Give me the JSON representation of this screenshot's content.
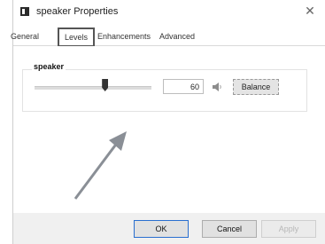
{
  "window": {
    "title": "speaker Properties",
    "close_glyph": "✕"
  },
  "tabs": [
    {
      "label": "General",
      "selected": false
    },
    {
      "label": "Levels",
      "selected": true
    },
    {
      "label": "Enhancements",
      "selected": false
    },
    {
      "label": "Advanced",
      "selected": false
    }
  ],
  "levels": {
    "group_label": "speaker",
    "slider_value": 60,
    "value_text": "60",
    "speaker_icon": "speaker-icon",
    "balance_label": "Balance"
  },
  "buttons": {
    "ok": "OK",
    "cancel": "Cancel",
    "apply": "Apply"
  },
  "colors": {
    "accent": "#2a6fcf",
    "annotation_arrow": "#8a8f96"
  }
}
